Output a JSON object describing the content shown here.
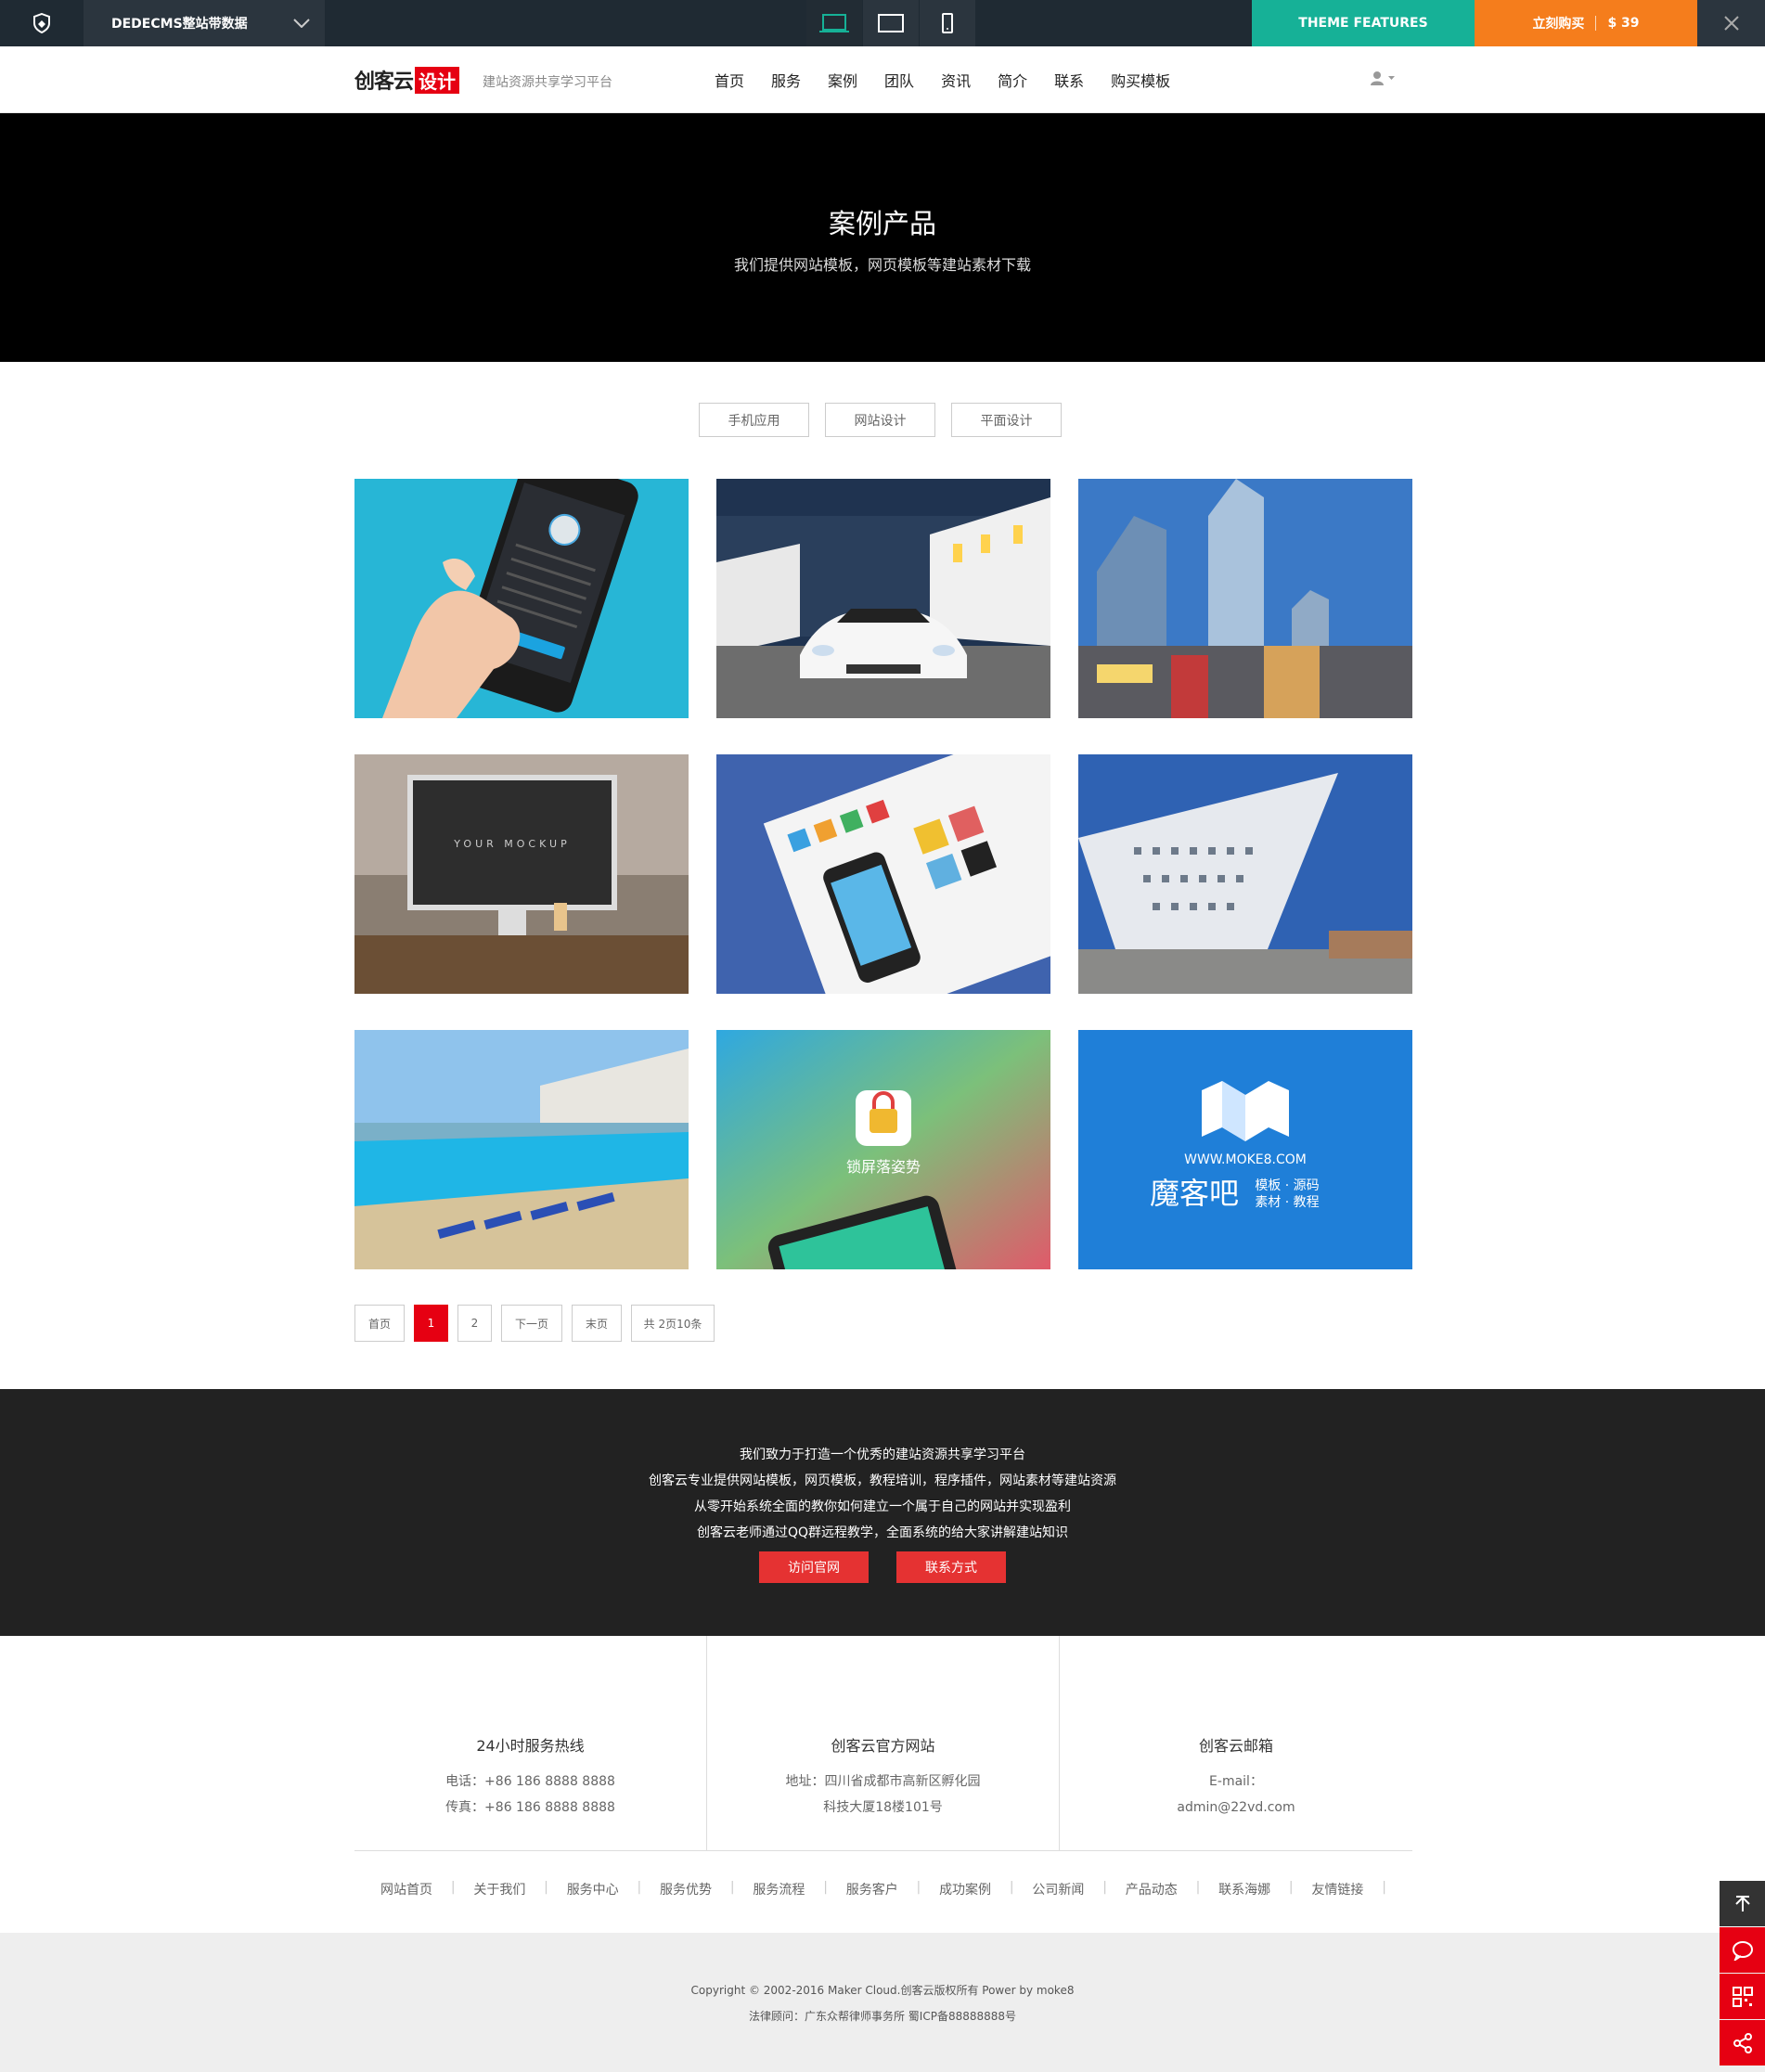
{
  "topbar": {
    "theme_select": "DEDECMS整站带数据",
    "features_label": "THEME FEATURES",
    "buy_label": "立刻购买",
    "price": "$ 39"
  },
  "header": {
    "logo_text": "创客云",
    "logo_highlight": "设计",
    "tagline": "建站资源共享学习平台",
    "nav": [
      "首页",
      "服务",
      "案例",
      "团队",
      "资讯",
      "简介",
      "联系",
      "购买模板"
    ]
  },
  "hero": {
    "title": "案例产品",
    "subtitle": "我们提供网站模板，网页模板等建站素材下载"
  },
  "filters": [
    "手机应用",
    "网站设计",
    "平面设计"
  ],
  "cards": [
    {
      "name": "phone-in-hand"
    },
    {
      "name": "white-sports-car"
    },
    {
      "name": "glass-towers"
    },
    {
      "name": "desktop-mockup",
      "text": "YOUR  MOCKUP"
    },
    {
      "name": "samsung-app-ui"
    },
    {
      "name": "triangle-building"
    },
    {
      "name": "beach-pool"
    },
    {
      "name": "lockscreen-app",
      "text": "锁屏落姿势"
    },
    {
      "name": "moke8-brand",
      "url": "WWW.MOKE8.COM",
      "brand": "魔客吧",
      "tag1": "模板 · 源码",
      "tag2": "素材 · 教程"
    }
  ],
  "pager": {
    "first": "首页",
    "p1": "1",
    "p2": "2",
    "next": "下一页",
    "last": "末页",
    "total": "共 2页10条"
  },
  "footer_dark": {
    "line1": "我们致力于打造一个优秀的建站资源共享学习平台",
    "line2": "创客云专业提供网站模板，网页模板，教程培训，程序插件，网站素材等建站资源",
    "line3": "从零开始系统全面的教你如何建立一个属于自己的网站并实现盈利",
    "line4": "创客云老师通过QQ群远程教学，全面系统的给大家讲解建站知识",
    "btn_visit": "访问官网",
    "btn_contact": "联系方式"
  },
  "contacts": [
    {
      "title": "24小时服务热线",
      "l1": "电话：+86 186 8888 8888",
      "l2": "传真：+86 186 8888 8888"
    },
    {
      "title": "创客云官方网站",
      "l1": "地址：四川省成都市高新区孵化园",
      "l2": "科技大厦18楼101号"
    },
    {
      "title": "创客云邮箱",
      "l1": "E-mail：",
      "l2": "admin@22vd.com"
    }
  ],
  "footer_links": [
    "网站首页",
    "关于我们",
    "服务中心",
    "服务优势",
    "服务流程",
    "服务客户",
    "成功案例",
    "公司新闻",
    "产品动态",
    "联系海娜",
    "友情链接"
  ],
  "copyright": {
    "line1": "Copyright © 2002-2016 Maker Cloud.创客云版权所有 Power by moke8",
    "line2": "法律顾问：广东众帮律师事务所 蜀ICP备88888888号"
  },
  "colors": {
    "accent": "#e60012",
    "teal": "#16b197",
    "orange": "#f57d1c"
  }
}
